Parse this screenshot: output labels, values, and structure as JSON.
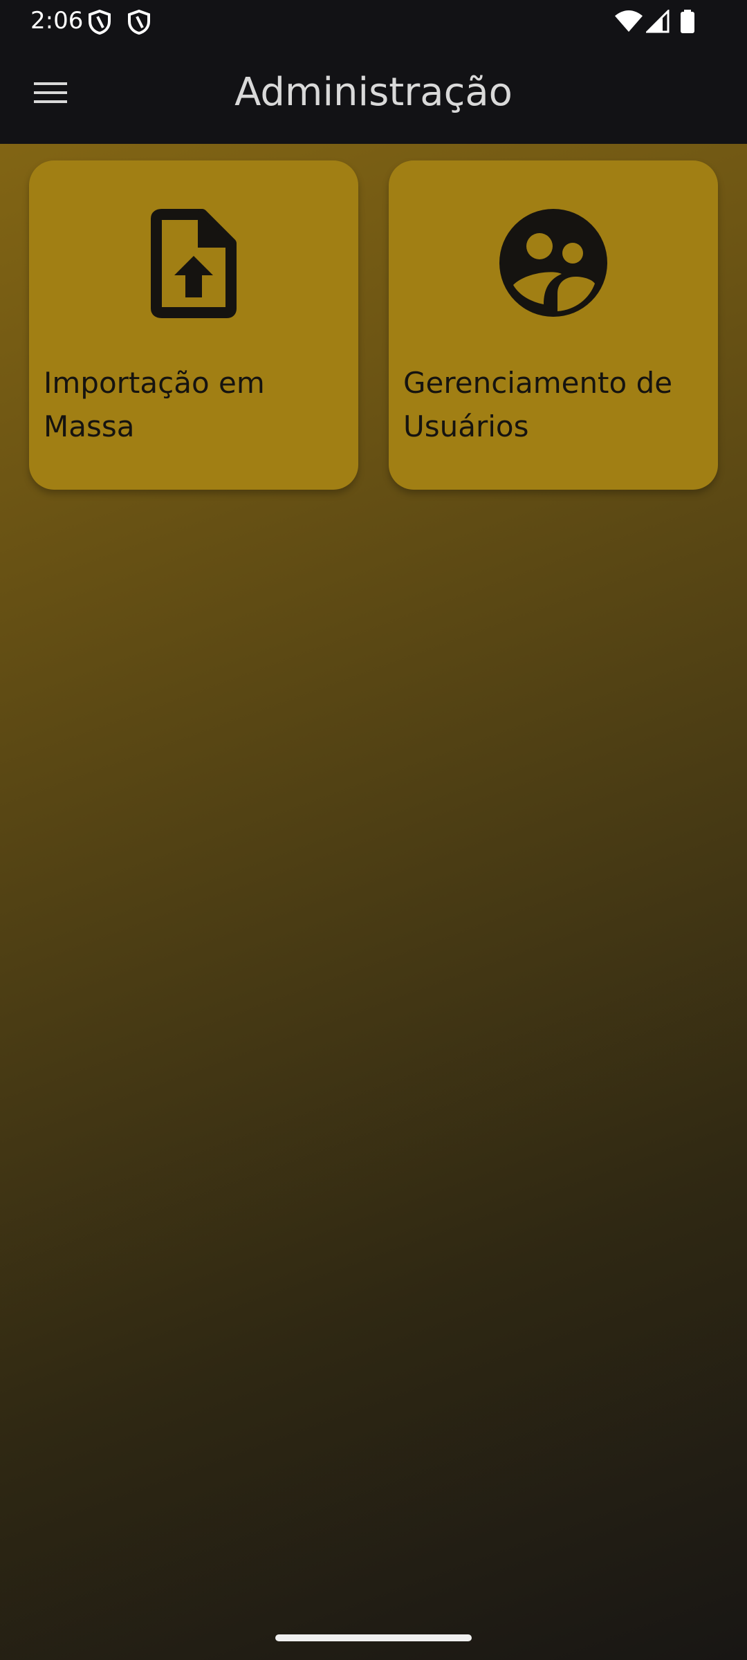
{
  "status_bar": {
    "time": "2:06",
    "left_icons": [
      "shield-icon",
      "shield-icon"
    ],
    "right_icons": [
      "wifi-icon",
      "cellular-signal-icon",
      "battery-icon"
    ]
  },
  "app_bar": {
    "title": "Administração",
    "menu_icon": "hamburger-menu-icon"
  },
  "cards": [
    {
      "label": "Importação em Massa",
      "icon": "file-upload-icon"
    },
    {
      "label": "Gerenciamento de Usuários",
      "icon": "supervised-user-circle-icon"
    }
  ],
  "colors": {
    "app_bar": "#121215",
    "card": "#a17f14",
    "background_top": "#8a6b14",
    "background_bottom": "#181614",
    "icon": "#151310"
  }
}
